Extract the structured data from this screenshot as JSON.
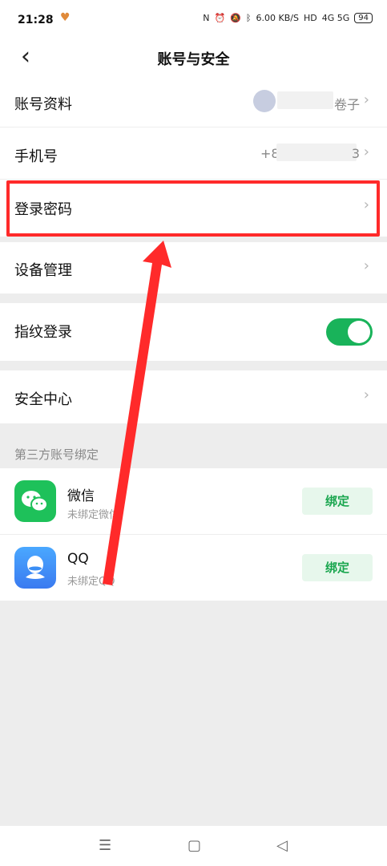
{
  "status_bar": {
    "time": "21:28",
    "speed": "6.00 KB/S",
    "hd": "HD",
    "network": "4G 5G",
    "battery": "94"
  },
  "header": {
    "title": "账号与安全"
  },
  "rows": {
    "profile": {
      "label": "账号资料",
      "value_suffix": "卷子"
    },
    "phone": {
      "label": "手机号",
      "value_prefix": "+8",
      "value_suffix": "3"
    },
    "password": {
      "label": "登录密码"
    },
    "devices": {
      "label": "设备管理"
    },
    "fingerprint": {
      "label": "指纹登录",
      "enabled": true
    },
    "security_center": {
      "label": "安全中心"
    }
  },
  "third_party": {
    "section_title": "第三方账号绑定",
    "items": [
      {
        "name": "微信",
        "status": "未绑定微信",
        "button": "绑定"
      },
      {
        "name": "QQ",
        "status": "未绑定QQ",
        "button": "绑定"
      }
    ]
  },
  "colors": {
    "accent_green": "#19b35a",
    "highlight_red": "#ff2a2a",
    "wechat": "#1ec15a",
    "qq": "#3a8ef5"
  }
}
